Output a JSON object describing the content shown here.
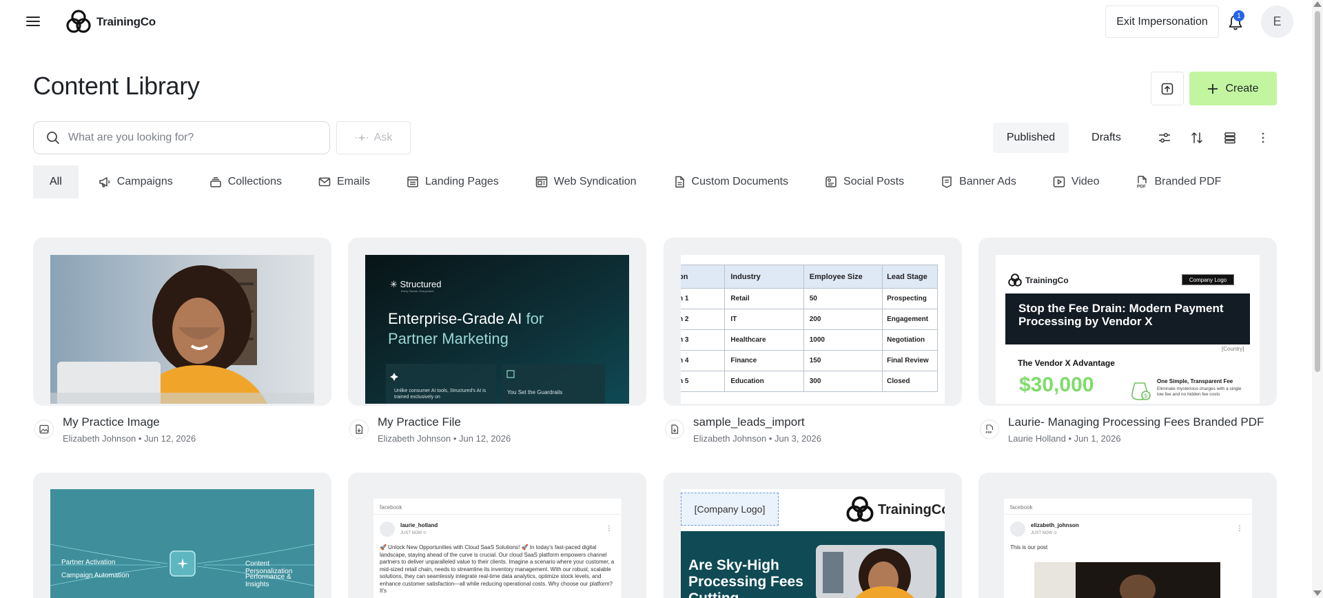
{
  "header": {
    "brand_name": "TrainingCo",
    "exit_label": "Exit Impersonation",
    "notification_count": "1",
    "avatar_initial": "E"
  },
  "page": {
    "title": "Content Library",
    "create_label": "Create"
  },
  "search": {
    "placeholder": "What are you looking for?",
    "ask_label": "Ask"
  },
  "status_toggle": {
    "published": "Published",
    "drafts": "Drafts"
  },
  "tabs": [
    {
      "label": "All",
      "icon": "none"
    },
    {
      "label": "Campaigns",
      "icon": "megaphone-icon"
    },
    {
      "label": "Collections",
      "icon": "stack-icon"
    },
    {
      "label": "Emails",
      "icon": "mail-icon"
    },
    {
      "label": "Landing Pages",
      "icon": "layout-icon"
    },
    {
      "label": "Web Syndication",
      "icon": "browser-icon"
    },
    {
      "label": "Custom Documents",
      "icon": "document-icon"
    },
    {
      "label": "Social Posts",
      "icon": "social-icon"
    },
    {
      "label": "Banner Ads",
      "icon": "banner-icon"
    },
    {
      "label": "Video",
      "icon": "play-icon"
    },
    {
      "label": "Branded PDF",
      "icon": "pdf-icon"
    }
  ],
  "cards": [
    {
      "title": "My Practice Image",
      "author": "Elizabeth Johnson",
      "date": "Jun 12, 2026",
      "type_icon": "image-icon"
    },
    {
      "title": "My Practice File",
      "author": "Elizabeth Johnson",
      "date": "Jun 12, 2026",
      "type_icon": "file-icon"
    },
    {
      "title": "sample_leads_import",
      "author": "Elizabeth Johnson",
      "date": "Jun 3, 2026",
      "type_icon": "file-icon"
    },
    {
      "title": "Laurie- Managing Processing Fees Branded PDF",
      "author": "Laurie Holland",
      "date": "Jun 1, 2026",
      "type_icon": "pdf-icon"
    }
  ],
  "thumb_file": {
    "brand": "Structured",
    "brand_small": "Every Partner, Everywhere",
    "headline_1": "Enterprise-Grade AI ",
    "headline_accent": "for",
    "headline_2": "Partner Marketing",
    "panel_1": "Unlike consumer AI tools, Structured's AI is trained exclusively on",
    "panel_2": "You Set the Guardrails"
  },
  "thumb_table": {
    "headers": [
      "on",
      "Industry",
      "Employee Size",
      "Lead Stage"
    ],
    "rows": [
      [
        "n 1",
        "Retail",
        "50",
        "Prospecting"
      ],
      [
        "n 2",
        "IT",
        "200",
        "Engagement"
      ],
      [
        "n 3",
        "Healthcare",
        "1000",
        "Negotiation"
      ],
      [
        "n 4",
        "Finance",
        "150",
        "Final Review"
      ],
      [
        "n 5",
        "Education",
        "300",
        "Closed"
      ]
    ]
  },
  "thumb_pdf": {
    "brand": "TrainingCo",
    "company_logo": "Company Logo",
    "headline": "Stop the Fee Drain: Modern Payment Processing by Vendor X",
    "country": "[Country]",
    "advantage": "The Vendor X Advantage",
    "price": "$30,000",
    "fee_title": "One Simple, Transparent Fee",
    "fee_text": "Eliminate mysterious charges with a single low fee and no hidden fee costs"
  },
  "thumb_row2_1": {
    "left_1": "Partner Activation",
    "left_2": "Campaign Automation",
    "right_1": "Content Personalization",
    "right_2": "Performance & Insights"
  },
  "thumb_row2_2": {
    "network": "facebook",
    "user": "laurie_holland",
    "time": "JUST NOW ⊙",
    "text": "🚀 Unlock New Opportunities with Cloud SaaS Solutions! 🚀 In today's fast-paced digital landscape, staying ahead of the curve is crucial. Our cloud SaaS platform empowers channel partners to deliver unparalleled value to their clients. Imagine a scenario where your customer, a mid-sized retail chain, needs to streamline its inventory management. With our robust, scalable solutions, they can seamlessly integrate real-time data analytics, optimize stock levels, and enhance customer satisfaction—all while reducing operational costs. Why choose our platform? It's"
  },
  "thumb_row2_3": {
    "company_logo": "[Company Logo]",
    "brand": "TrainingCo",
    "headline": "Are Sky-High Processing Fees Cutting"
  },
  "thumb_row2_4": {
    "network": "facebook",
    "user": "elizabeth_johnson",
    "time": "JUST NOW ⊙",
    "text": "This is our post"
  },
  "colors": {
    "create_bg": "#c3f5a1",
    "badge": "#2563eb",
    "teal": "#0f4a55"
  }
}
